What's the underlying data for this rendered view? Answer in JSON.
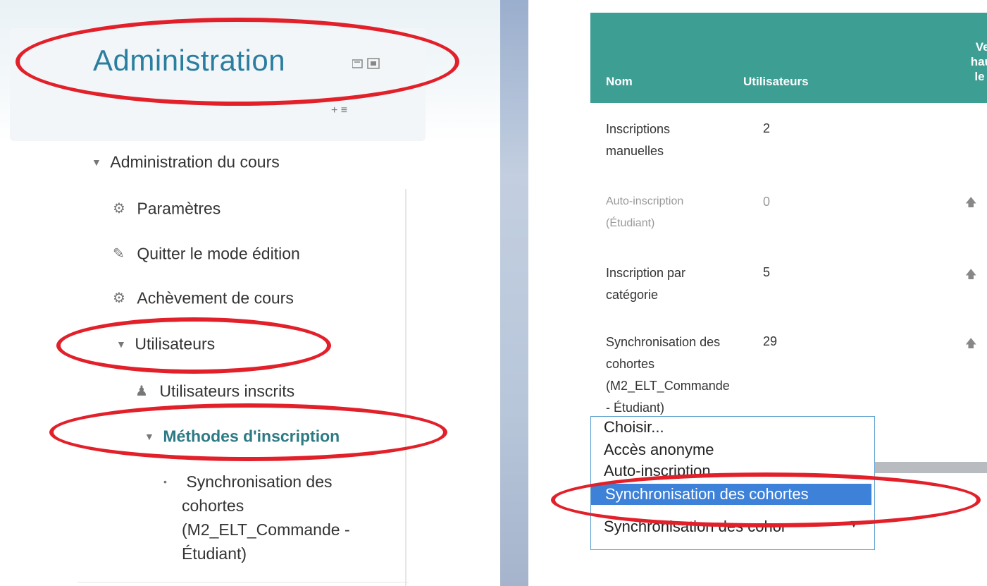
{
  "colors": {
    "title": "#2a7ea0",
    "header_bg": "#3d9e93",
    "selected_bg": "#3d82d8",
    "annotation": "#e2202a"
  },
  "block": {
    "title": "Administration",
    "dock_icon": "dock-icon",
    "move_icons": "+ ≡"
  },
  "nav": {
    "course_admin": "Administration du cours",
    "settings": "Paramètres",
    "edit_mode": "Quitter le mode édition",
    "completion": "Achèvement de cours",
    "users": "Utilisateurs",
    "enrolled_users": "Utilisateurs inscrits",
    "methods": "Méthodes d'inscription",
    "cohort_sync_line1": "Synchronisation des",
    "cohort_sync_line2": "cohortes",
    "cohort_sync_line3": "(M2_ELT_Commande -",
    "cohort_sync_line4": "Étudiant)"
  },
  "table": {
    "header_name": "Nom",
    "header_users": "Utilisateurs",
    "header_order_l1": "Ver",
    "header_order_l2": "haut/",
    "header_order_l3": "le b",
    "rows": [
      {
        "name_l1": "Inscriptions",
        "name_l2": "manuelles",
        "count": "2",
        "arrow": ""
      },
      {
        "name_l1": "Auto-inscription",
        "name_l2": "(Étudiant)",
        "count": "0",
        "arrow": "🡅"
      },
      {
        "name_l1": "Inscription par",
        "name_l2": "catégorie",
        "count": "5",
        "arrow": "🡅"
      },
      {
        "name_l1": "Synchronisation des",
        "name_l2": "cohortes",
        "name_l3": "(M2_ELT_Commande",
        "name_l4": "- Étudiant)",
        "count": "29",
        "arrow": "🡅"
      }
    ]
  },
  "select": {
    "options": [
      "Choisir...",
      "Accès anonyme",
      "Auto-inscription"
    ],
    "selected_option": "Synchronisation des cohortes",
    "current_value": "Synchronisation des cohor"
  }
}
